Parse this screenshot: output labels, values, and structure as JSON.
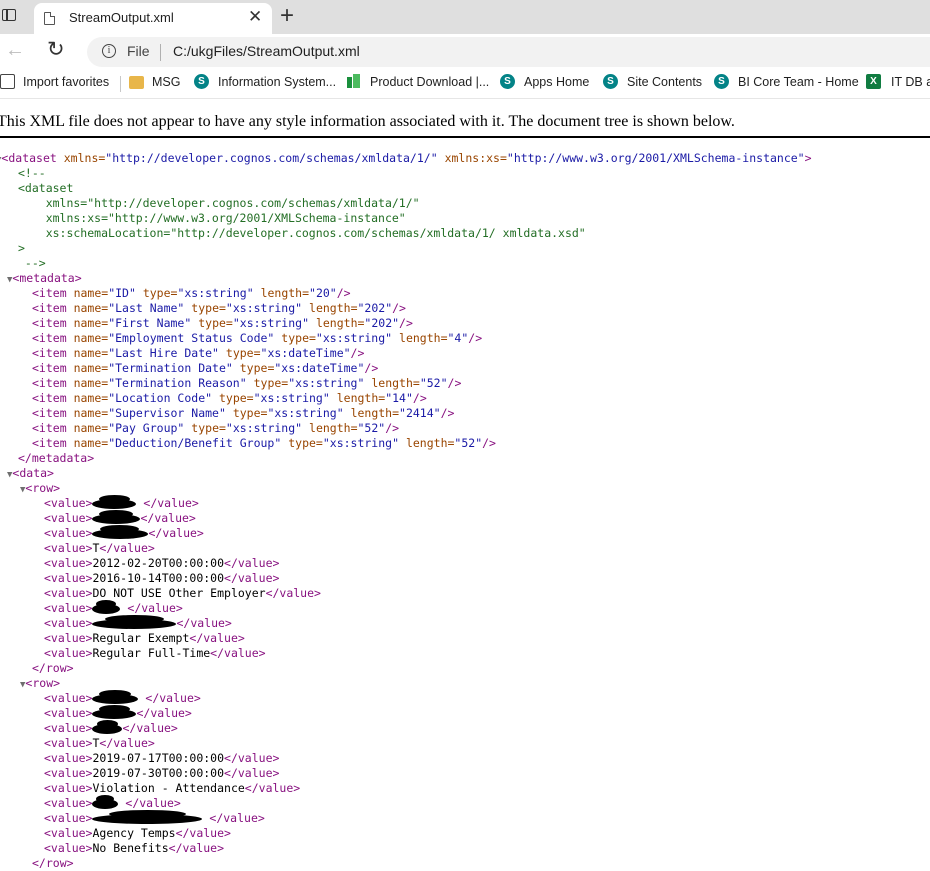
{
  "browser": {
    "tab_title": "StreamOutput.xml",
    "omnibox_scheme": "File",
    "omnibox_url": "C:/ukgFiles/StreamOutput.xml",
    "favorites": [
      {
        "label": "Import favorites",
        "icon": "import-icon"
      },
      {
        "label": "MSG",
        "icon": "folder-icon"
      },
      {
        "label": "Information System...",
        "icon": "sharepoint-icon"
      },
      {
        "label": "Product Download |...",
        "icon": "product-icon"
      },
      {
        "label": "Apps Home",
        "icon": "sharepoint-icon"
      },
      {
        "label": "Site Contents",
        "icon": "sharepoint-icon"
      },
      {
        "label": "BI Core Team - Home",
        "icon": "sharepoint-icon"
      },
      {
        "label": "IT DB ar",
        "icon": "excel-icon"
      }
    ],
    "sharepoint_glyph": "S",
    "excel_glyph": "X"
  },
  "viewer": {
    "info_message": "This XML file does not appear to have any style information associated with it. The document tree is shown below."
  },
  "xml": {
    "root_open": {
      "tag": "<dataset",
      "attr1_name": "xmlns=",
      "attr1_value": "\"http://developer.cognos.com/schemas/xmldata/1/\"",
      "attr2_name": "xmlns:xs=",
      "attr2_value": "\"http://www.w3.org/2001/XMLSchema-instance\"",
      "close": ">"
    },
    "comment_lines": [
      "<!--",
      "<dataset",
      "    xmlns=\"http://developer.cognos.com/schemas/xmldata/1/\"",
      "    xmlns:xs=\"http://www.w3.org/2001/XMLSchema-instance\"",
      "    xs:schemaLocation=\"http://developer.cognos.com/schemas/xmldata/1/ xmldata.xsd\"",
      ">",
      " -->"
    ],
    "metadata_open": "<metadata>",
    "metadata_close": "</metadata>",
    "items": [
      {
        "name": "\"ID\"",
        "type": "\"xs:string\"",
        "length": "\"20\""
      },
      {
        "name": "\"Last Name\"",
        "type": "\"xs:string\"",
        "length": "\"202\""
      },
      {
        "name": "\"First Name\"",
        "type": "\"xs:string\"",
        "length": "\"202\""
      },
      {
        "name": "\"Employment Status Code\"",
        "type": "\"xs:string\"",
        "length": "\"4\""
      },
      {
        "name": "\"Last Hire Date\"",
        "type": "\"xs:dateTime\"",
        "length": null
      },
      {
        "name": "\"Termination Date\"",
        "type": "\"xs:dateTime\"",
        "length": null
      },
      {
        "name": "\"Termination Reason\"",
        "type": "\"xs:string\"",
        "length": "\"52\""
      },
      {
        "name": "\"Location Code\"",
        "type": "\"xs:string\"",
        "length": "\"14\""
      },
      {
        "name": "\"Supervisor Name\"",
        "type": "\"xs:string\"",
        "length": "\"2414\""
      },
      {
        "name": "\"Pay Group\"",
        "type": "\"xs:string\"",
        "length": "\"52\""
      },
      {
        "name": "\"Deduction/Benefit Group\"",
        "type": "\"xs:string\"",
        "length": "\"52\""
      }
    ],
    "item_tag": "<item",
    "item_attr_name": "name=",
    "item_attr_type": "type=",
    "item_attr_length": "length=",
    "item_close": "/>",
    "data_open": "<data>",
    "row_open": "<row>",
    "row_close": "</row>",
    "value_open": "<value>",
    "value_close": "</value>",
    "rows": [
      {
        "values": [
          "",
          "",
          "",
          "T",
          "2012-02-20T00:00:00",
          "2016-10-14T00:00:00",
          "DO NOT USE Other Employer",
          "",
          "",
          "Regular Exempt",
          "Regular Full-Time"
        ],
        "redacted": [
          true,
          true,
          true,
          false,
          false,
          false,
          false,
          true,
          true,
          false,
          false
        ],
        "trailing_space": [
          true,
          false,
          false,
          false,
          false,
          false,
          false,
          true,
          false,
          false,
          false
        ]
      },
      {
        "values": [
          "",
          "",
          "",
          "T",
          "2019-07-17T00:00:00",
          "2019-07-30T00:00:00",
          "Violation - Attendance",
          "",
          "",
          "Agency Temps",
          "No Benefits"
        ],
        "redacted": [
          true,
          true,
          true,
          false,
          false,
          false,
          false,
          true,
          true,
          false,
          false
        ],
        "trailing_space": [
          true,
          false,
          false,
          false,
          false,
          false,
          false,
          true,
          true,
          false,
          false
        ]
      }
    ]
  }
}
